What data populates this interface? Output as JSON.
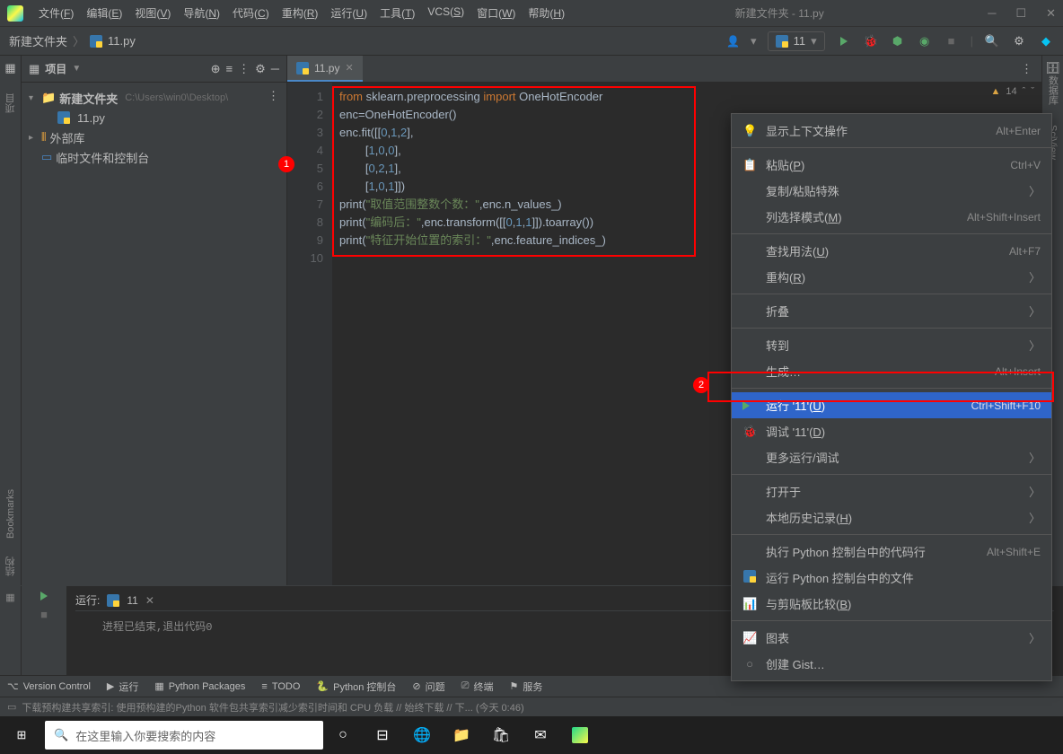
{
  "title_bar": {
    "menus": [
      "文件(F)",
      "编辑(E)",
      "视图(V)",
      "导航(N)",
      "代码(C)",
      "重构(R)",
      "运行(U)",
      "工具(T)",
      "VCS(S)",
      "窗口(W)",
      "帮助(H)"
    ],
    "window_title": "新建文件夹 - 11.py"
  },
  "breadcrumb": {
    "root": "新建文件夹",
    "file": "11.py"
  },
  "run_config": {
    "name": "11"
  },
  "project_panel": {
    "title": "项目",
    "tree": {
      "root": {
        "name": "新建文件夹",
        "path": "C:\\Users\\win0\\Desktop\\"
      },
      "file": "11.py",
      "external": "外部库",
      "scratches": "临时文件和控制台"
    }
  },
  "left_tabs": {
    "project": "项目",
    "bookmarks": "Bookmarks",
    "structure": "结构"
  },
  "right_tabs": {
    "database": "数据库",
    "sciview": "SciView"
  },
  "editor": {
    "tab_name": "11.py",
    "warnings": "14",
    "lines": [
      {
        "n": 1,
        "html": "<span class='kw'>from</span> sklearn.preprocessing <span class='kw'>import</span> OneHotEncoder"
      },
      {
        "n": 2,
        "html": "enc=OneHotEncoder()"
      },
      {
        "n": 3,
        "html": "enc.fit([[<span class='num'>0</span>,<span class='num'>1</span>,<span class='num'>2</span>],"
      },
      {
        "n": 4,
        "html": "        [<span class='num'>1</span>,<span class='num'>0</span>,<span class='num'>0</span>],"
      },
      {
        "n": 5,
        "html": "        [<span class='num'>0</span>,<span class='num'>2</span>,<span class='num'>1</span>],"
      },
      {
        "n": 6,
        "html": "        [<span class='num'>1</span>,<span class='num'>0</span>,<span class='num'>1</span>]])"
      },
      {
        "n": 7,
        "html": "print(<span class='str'>\"取值范围整数个数：\"</span>,enc.n_values_)"
      },
      {
        "n": 8,
        "html": "print(<span class='str'>\"编码后：\"</span>,enc.transform([[<span class='num'>0</span>,<span class='num'>1</span>,<span class='num'>1</span>]]).toarray())"
      },
      {
        "n": 9,
        "html": "print(<span class='str'>\"特征开始位置的索引：\"</span>,enc.feature_indices_)"
      },
      {
        "n": 10,
        "html": ""
      }
    ]
  },
  "context_menu": [
    {
      "icon": "💡",
      "label": "显示上下文操作",
      "shortcut": "Alt+Enter"
    },
    {
      "sep": true
    },
    {
      "icon": "📋",
      "label": "粘贴(P)",
      "shortcut": "Ctrl+V"
    },
    {
      "label": "复制/粘贴特殊",
      "sub": true
    },
    {
      "label": "列选择模式(M)",
      "shortcut": "Alt+Shift+Insert"
    },
    {
      "sep": true
    },
    {
      "label": "查找用法(U)",
      "shortcut": "Alt+F7"
    },
    {
      "label": "重构(R)",
      "sub": true
    },
    {
      "sep": true
    },
    {
      "label": "折叠",
      "sub": true
    },
    {
      "sep": true
    },
    {
      "label": "转到",
      "sub": true
    },
    {
      "label": "生成…",
      "shortcut": "Alt+Insert"
    },
    {
      "sep": true
    },
    {
      "icon": "▶",
      "label": "运行 '11'(U)",
      "shortcut": "Ctrl+Shift+F10",
      "highlight": true
    },
    {
      "icon": "🐞",
      "label": "调试 '11'(D)"
    },
    {
      "label": "更多运行/调试",
      "sub": true
    },
    {
      "sep": true
    },
    {
      "label": "打开于",
      "sub": true
    },
    {
      "label": "本地历史记录(H)",
      "sub": true
    },
    {
      "sep": true
    },
    {
      "label": "执行 Python 控制台中的代码行",
      "shortcut": "Alt+Shift+E"
    },
    {
      "icon": "py",
      "label": "运行 Python 控制台中的文件"
    },
    {
      "icon": "📊",
      "label": "与剪贴板比较(B)"
    },
    {
      "sep": true
    },
    {
      "icon": "📈",
      "label": "图表",
      "sub": true
    },
    {
      "icon": "gh",
      "label": "创建 Gist…"
    }
  ],
  "run_panel": {
    "title": "运行:",
    "config": "11",
    "output": "进程已结束,退出代码0"
  },
  "bottom_tools": [
    "Version Control",
    "运行",
    "Python Packages",
    "TODO",
    "Python 控制台",
    "问题",
    "终端",
    "服务"
  ],
  "status_bar": "下载预构建共享索引: 使用预构建的Python 软件包共享索引减少索引时间和 CPU 负载 // 始终下载 // 下... (今天 0:46)",
  "taskbar": {
    "search_placeholder": "在这里输入你要搜索的内容"
  },
  "callouts": {
    "one": "1",
    "two": "2"
  }
}
